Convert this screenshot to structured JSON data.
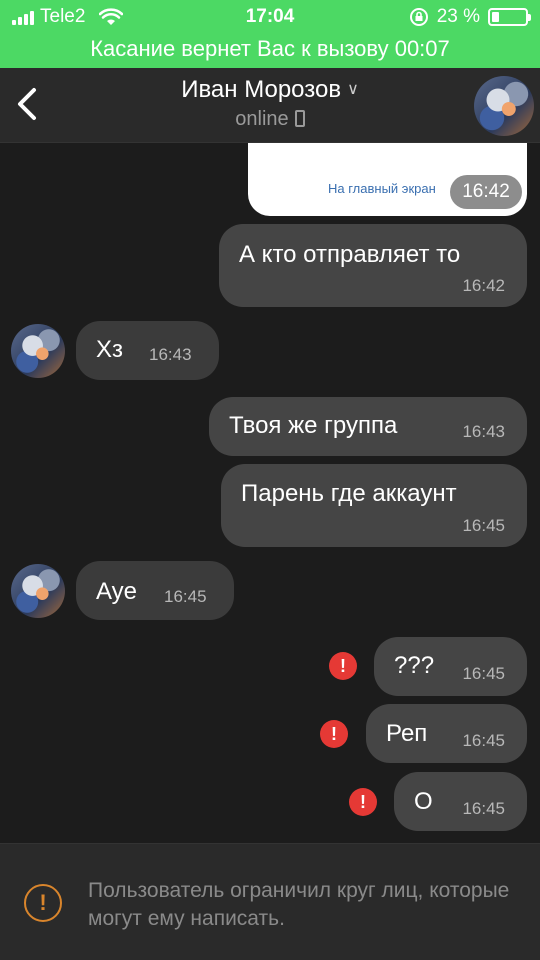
{
  "status_bar": {
    "carrier": "Tele2",
    "time": "17:04",
    "battery": "23 %",
    "battery_level": 0.23,
    "call_banner": "Касание вернет Вас к вызову 00:07"
  },
  "header": {
    "contact_name": "Иван Морозов",
    "status": "online"
  },
  "shared_card": {
    "link_text": "На главный экран",
    "time": "16:42"
  },
  "messages": [
    {
      "direction": "out",
      "text": "А кто отправляет то",
      "time": "16:42"
    },
    {
      "direction": "in",
      "text": "Хз",
      "time": "16:43"
    },
    {
      "direction": "out",
      "text": "Твоя же группа",
      "time": "16:43"
    },
    {
      "direction": "out",
      "text": "Парень где аккаунт",
      "time": "16:45"
    },
    {
      "direction": "in",
      "text": "Aye",
      "time": "16:45"
    },
    {
      "direction": "out",
      "text": "???",
      "time": "16:45",
      "failed": true
    },
    {
      "direction": "out",
      "text": "Реп",
      "time": "16:45",
      "failed": true
    },
    {
      "direction": "out",
      "text": "О",
      "time": "16:45",
      "failed": true
    }
  ],
  "footer": {
    "notice": "Пользователь ограничил круг лиц, которые могут ему написать."
  },
  "colors": {
    "call_bar": "#4cd964",
    "background": "#1c1c1c",
    "bubble": "#454545",
    "error": "#e53935",
    "warning": "#d9852c"
  }
}
